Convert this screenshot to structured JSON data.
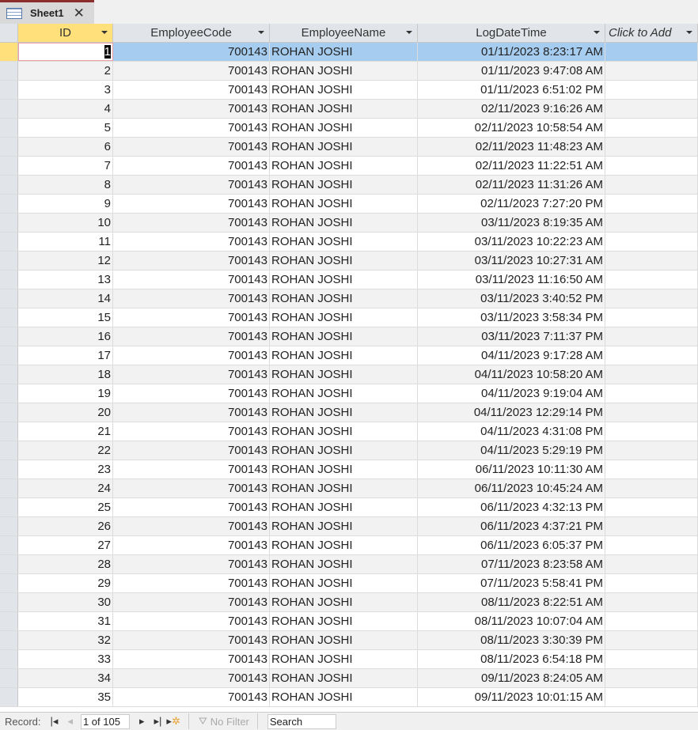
{
  "tab": {
    "title": "Sheet1"
  },
  "columns": {
    "id": "ID",
    "code": "EmployeeCode",
    "name": "EmployeeName",
    "log": "LogDateTime",
    "add": "Click to Add"
  },
  "rows": [
    [
      "1",
      "700143",
      "ROHAN  JOSHI",
      "01/11/2023 8:23:17 AM"
    ],
    [
      "2",
      "700143",
      "ROHAN  JOSHI",
      "01/11/2023 9:47:08 AM"
    ],
    [
      "3",
      "700143",
      "ROHAN  JOSHI",
      "01/11/2023 6:51:02 PM"
    ],
    [
      "4",
      "700143",
      "ROHAN  JOSHI",
      "02/11/2023 9:16:26 AM"
    ],
    [
      "5",
      "700143",
      "ROHAN  JOSHI",
      "02/11/2023 10:58:54 AM"
    ],
    [
      "6",
      "700143",
      "ROHAN  JOSHI",
      "02/11/2023 11:48:23 AM"
    ],
    [
      "7",
      "700143",
      "ROHAN  JOSHI",
      "02/11/2023 11:22:51 AM"
    ],
    [
      "8",
      "700143",
      "ROHAN  JOSHI",
      "02/11/2023 11:31:26 AM"
    ],
    [
      "9",
      "700143",
      "ROHAN  JOSHI",
      "02/11/2023 7:27:20 PM"
    ],
    [
      "10",
      "700143",
      "ROHAN  JOSHI",
      "03/11/2023 8:19:35 AM"
    ],
    [
      "11",
      "700143",
      "ROHAN  JOSHI",
      "03/11/2023 10:22:23 AM"
    ],
    [
      "12",
      "700143",
      "ROHAN  JOSHI",
      "03/11/2023 10:27:31 AM"
    ],
    [
      "13",
      "700143",
      "ROHAN  JOSHI",
      "03/11/2023 11:16:50 AM"
    ],
    [
      "14",
      "700143",
      "ROHAN  JOSHI",
      "03/11/2023 3:40:52 PM"
    ],
    [
      "15",
      "700143",
      "ROHAN  JOSHI",
      "03/11/2023 3:58:34 PM"
    ],
    [
      "16",
      "700143",
      "ROHAN  JOSHI",
      "03/11/2023 7:11:37 PM"
    ],
    [
      "17",
      "700143",
      "ROHAN  JOSHI",
      "04/11/2023 9:17:28 AM"
    ],
    [
      "18",
      "700143",
      "ROHAN  JOSHI",
      "04/11/2023 10:58:20 AM"
    ],
    [
      "19",
      "700143",
      "ROHAN  JOSHI",
      "04/11/2023 9:19:04 AM"
    ],
    [
      "20",
      "700143",
      "ROHAN  JOSHI",
      "04/11/2023 12:29:14 PM"
    ],
    [
      "21",
      "700143",
      "ROHAN  JOSHI",
      "04/11/2023 4:31:08 PM"
    ],
    [
      "22",
      "700143",
      "ROHAN  JOSHI",
      "04/11/2023 5:29:19 PM"
    ],
    [
      "23",
      "700143",
      "ROHAN  JOSHI",
      "06/11/2023 10:11:30 AM"
    ],
    [
      "24",
      "700143",
      "ROHAN  JOSHI",
      "06/11/2023 10:45:24 AM"
    ],
    [
      "25",
      "700143",
      "ROHAN  JOSHI",
      "06/11/2023 4:32:13 PM"
    ],
    [
      "26",
      "700143",
      "ROHAN  JOSHI",
      "06/11/2023 4:37:21 PM"
    ],
    [
      "27",
      "700143",
      "ROHAN  JOSHI",
      "06/11/2023 6:05:37 PM"
    ],
    [
      "28",
      "700143",
      "ROHAN  JOSHI",
      "07/11/2023 8:23:58 AM"
    ],
    [
      "29",
      "700143",
      "ROHAN  JOSHI",
      "07/11/2023 5:58:41 PM"
    ],
    [
      "30",
      "700143",
      "ROHAN  JOSHI",
      "08/11/2023 8:22:51 AM"
    ],
    [
      "31",
      "700143",
      "ROHAN  JOSHI",
      "08/11/2023 10:07:04 AM"
    ],
    [
      "32",
      "700143",
      "ROHAN  JOSHI",
      "08/11/2023 3:30:39 PM"
    ],
    [
      "33",
      "700143",
      "ROHAN  JOSHI",
      "08/11/2023 6:54:18 PM"
    ],
    [
      "34",
      "700143",
      "ROHAN  JOSHI",
      "09/11/2023 8:24:05 AM"
    ],
    [
      "35",
      "700143",
      "ROHAN  JOSHI",
      "09/11/2023 10:01:15 AM"
    ]
  ],
  "footer": {
    "record_label": "Record:",
    "record_value": "1 of 105",
    "filter_label": "No Filter",
    "search_value": "Search"
  }
}
